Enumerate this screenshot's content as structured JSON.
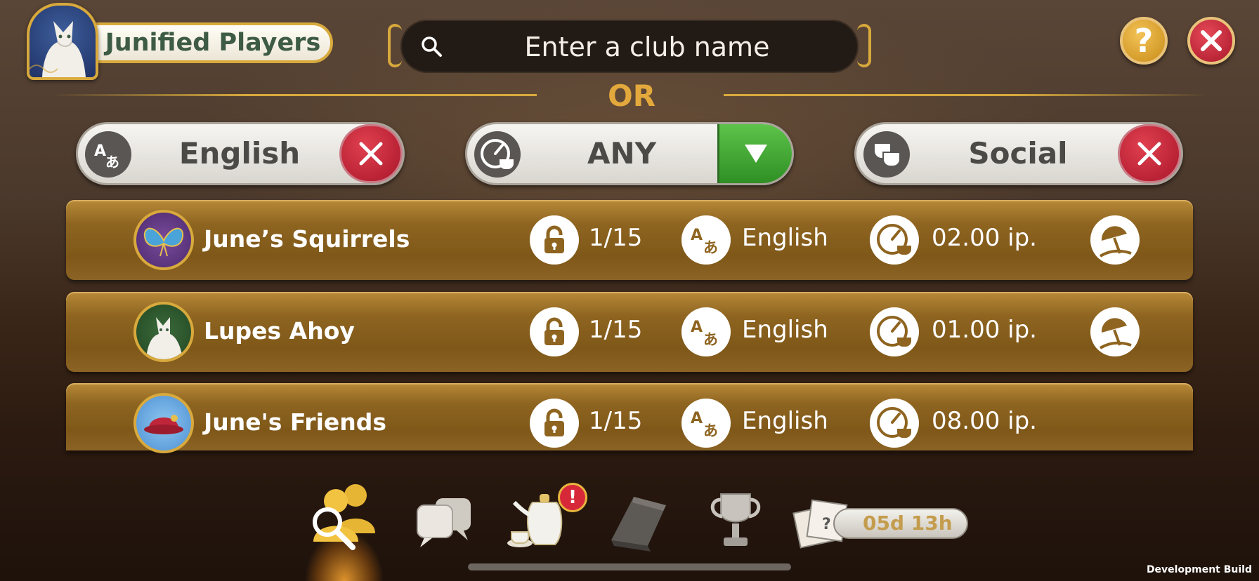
{
  "header": {
    "player_name": "Junified Players",
    "search": {
      "placeholder": "Enter a club name",
      "value": ""
    },
    "help_label": "?"
  },
  "divider_label": "OR",
  "filters": [
    {
      "label": "English",
      "icon": "language-icon",
      "action": "remove"
    },
    {
      "label": "ANY",
      "icon": "activity-timer-icon",
      "action": "dropdown"
    },
    {
      "label": "Social",
      "icon": "social-cups-icon",
      "action": "remove"
    }
  ],
  "clubs": [
    {
      "name": "June’s Squirrels",
      "members": "1/15",
      "language": "English",
      "time": "02.00 ip.",
      "emblem": "butterfly-mask",
      "has_beach_icon": true
    },
    {
      "name": "Lupes Ahoy",
      "members": "1/15",
      "language": "English",
      "time": "01.00 ip.",
      "emblem": "white-cat",
      "has_beach_icon": true
    },
    {
      "name": "June's Friends",
      "members": "1/15",
      "language": "English",
      "time": "08.00 ip.",
      "emblem": "red-hat",
      "has_beach_icon": false
    }
  ],
  "bottom_nav": {
    "items": [
      "club-search",
      "chat",
      "tea-service",
      "calendar-tent",
      "trophy",
      "mystery-photos"
    ],
    "active": "club-search",
    "badge": "!",
    "timer": "05d 13h"
  },
  "footer_note": "Development Build",
  "colors": {
    "gold": "#d8a93c",
    "row_brown": "#8e6420",
    "red_button": "#c21c30",
    "green_button": "#3da62f"
  }
}
